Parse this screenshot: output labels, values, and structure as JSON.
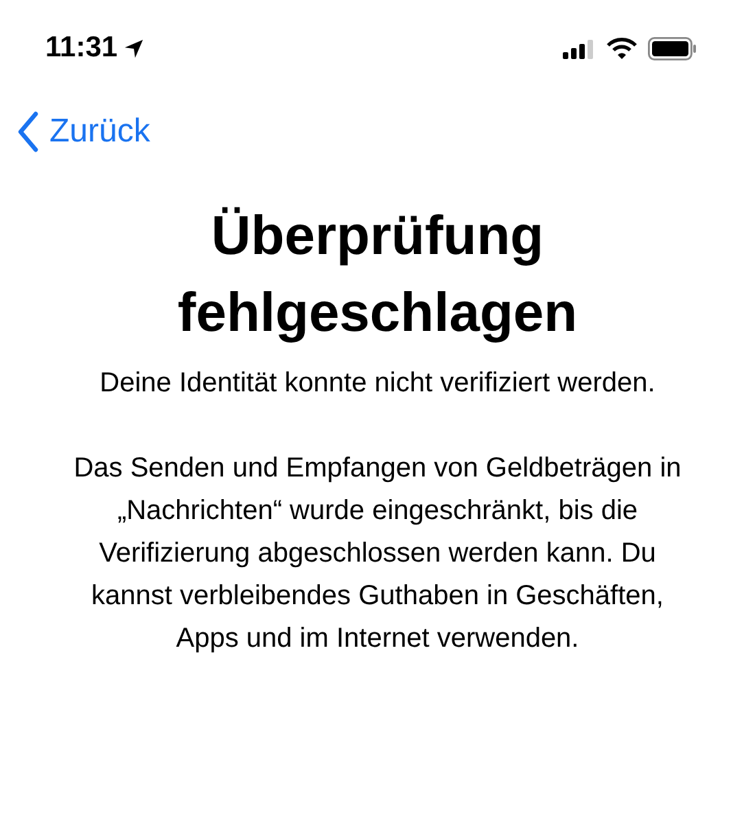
{
  "status_bar": {
    "time": "11:31"
  },
  "nav": {
    "back_label": "Zurück"
  },
  "title": "Überprüfung fehlgeschlagen",
  "subtitle": "Deine Identität konnte nicht verifiziert werden.",
  "body": "Das Senden und Empfangen von Geldbeträgen in „Nachrichten“ wurde eingeschränkt, bis die Verifizierung abgeschlossen werden kann. Du kannst verbleibendes Guthaben in Geschäften, Apps und im Internet verwenden."
}
